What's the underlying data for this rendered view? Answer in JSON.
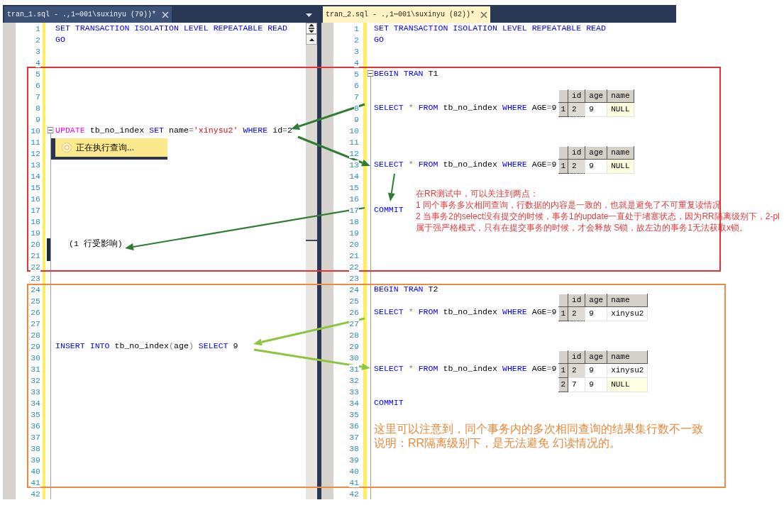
{
  "editor_left": {
    "tab": {
      "title": "tran_1.sql - .,1⋯001\\suxinyu (79))*",
      "selected": false
    },
    "lines": [
      {
        "number": "1",
        "tokens": [
          {
            "text": "SET TRANSACTION ISOLATION LEVEL REPEATABLE READ",
            "kind": "keyword"
          }
        ]
      },
      {
        "number": "2",
        "tokens": [
          {
            "text": "GO",
            "kind": "keyword"
          }
        ]
      },
      {
        "number": "3"
      },
      {
        "number": "4"
      },
      {
        "number": "5"
      },
      {
        "number": "6"
      },
      {
        "number": "7"
      },
      {
        "number": "8"
      },
      {
        "number": "9"
      },
      {
        "number": "10",
        "fold": true,
        "tokens": [
          {
            "text": "UPDATE",
            "kind": "special"
          },
          {
            "text": " tb_no_index ",
            "kind": "text"
          },
          {
            "text": "SET",
            "kind": "keyword"
          },
          {
            "text": " name",
            "kind": "text"
          },
          {
            "text": "=",
            "kind": "operator"
          },
          {
            "text": "'xinysu2'",
            "kind": "string"
          },
          {
            "text": " WHERE",
            "kind": "keyword"
          },
          {
            "text": " id",
            "kind": "text"
          },
          {
            "text": "=",
            "kind": "operator"
          },
          {
            "text": "2",
            "kind": "text"
          }
        ]
      },
      {
        "number": "11"
      },
      {
        "number": "12"
      },
      {
        "number": "13"
      },
      {
        "number": "14"
      },
      {
        "number": "15"
      },
      {
        "number": "16"
      },
      {
        "number": "17"
      },
      {
        "number": "18"
      },
      {
        "number": "19"
      },
      {
        "number": "20",
        "marker": true,
        "tokens": [
          {
            "text": "(1 行受影响)",
            "kind": "message"
          }
        ]
      },
      {
        "number": "21",
        "marker": true
      },
      {
        "number": "22"
      },
      {
        "number": "23"
      },
      {
        "number": "24"
      },
      {
        "number": "25"
      },
      {
        "number": "26"
      },
      {
        "number": "27"
      },
      {
        "number": "28"
      },
      {
        "number": "29",
        "tokens": [
          {
            "text": "INSERT INTO",
            "kind": "keyword"
          },
          {
            "text": " tb_no_index",
            "kind": "text"
          },
          {
            "text": "(",
            "kind": "operator"
          },
          {
            "text": "age",
            "kind": "text"
          },
          {
            "text": ")",
            "kind": "operator"
          },
          {
            "text": " SELECT",
            "kind": "keyword"
          },
          {
            "text": " 9",
            "kind": "text"
          }
        ]
      },
      {
        "number": "30"
      },
      {
        "number": "31"
      },
      {
        "number": "32"
      },
      {
        "number": "33"
      },
      {
        "number": "34"
      },
      {
        "number": "35"
      },
      {
        "number": "36"
      },
      {
        "number": "37"
      },
      {
        "number": "38"
      },
      {
        "number": "39"
      },
      {
        "number": "40"
      },
      {
        "number": "41"
      },
      {
        "number": "42"
      }
    ],
    "status_popup": {
      "text": "正在执行查询..."
    }
  },
  "editor_right": {
    "tab": {
      "title": "tran_2.sql - .,1⋯001\\suxinyu (82))*",
      "selected": true
    },
    "lines": [
      {
        "number": "1",
        "tokens": [
          {
            "text": "SET TRANSACTION ISOLATION LEVEL REPEATABLE READ",
            "kind": "keyword"
          }
        ]
      },
      {
        "number": "2",
        "tokens": [
          {
            "text": "GO",
            "kind": "keyword"
          }
        ]
      },
      {
        "number": "3"
      },
      {
        "number": "4"
      },
      {
        "number": "5",
        "fold": true,
        "tokens": [
          {
            "text": "BEGIN TRAN",
            "kind": "keyword"
          },
          {
            "text": " T1",
            "kind": "text"
          }
        ]
      },
      {
        "number": "6"
      },
      {
        "number": "7"
      },
      {
        "number": "8",
        "tokens": [
          {
            "text": "SELECT ",
            "kind": "keyword"
          },
          {
            "text": "*",
            "kind": "operator"
          },
          {
            "text": " FROM",
            "kind": "keyword"
          },
          {
            "text": " tb_no_index ",
            "kind": "text"
          },
          {
            "text": "WHERE",
            "kind": "keyword"
          },
          {
            "text": " AGE",
            "kind": "text"
          },
          {
            "text": "=",
            "kind": "operator"
          },
          {
            "text": "9",
            "kind": "text"
          }
        ],
        "result_grid": {
          "columns": [
            "id",
            "age",
            "name"
          ],
          "rows": [
            {
              "number": "1",
              "cells": [
                {
                  "text": "2",
                  "focused": true,
                  "null": false
                },
                {
                  "text": "9",
                  "focused": false,
                  "null": false
                },
                {
                  "text": "NULL",
                  "focused": false,
                  "null": true
                }
              ]
            }
          ]
        }
      },
      {
        "number": "9"
      },
      {
        "number": "10"
      },
      {
        "number": "11"
      },
      {
        "number": "12"
      },
      {
        "number": "13",
        "tokens": [
          {
            "text": "SELECT ",
            "kind": "keyword"
          },
          {
            "text": "*",
            "kind": "operator"
          },
          {
            "text": " FROM",
            "kind": "keyword"
          },
          {
            "text": " tb_no_index ",
            "kind": "text"
          },
          {
            "text": "WHERE",
            "kind": "keyword"
          },
          {
            "text": " AGE",
            "kind": "text"
          },
          {
            "text": "=",
            "kind": "operator"
          },
          {
            "text": "9",
            "kind": "text"
          }
        ],
        "result_grid": {
          "columns": [
            "id",
            "age",
            "name"
          ],
          "rows": [
            {
              "number": "1",
              "cells": [
                {
                  "text": "2",
                  "focused": true,
                  "null": false
                },
                {
                  "text": "9",
                  "focused": false,
                  "null": false
                },
                {
                  "text": "NULL",
                  "focused": false,
                  "null": true
                }
              ]
            }
          ]
        }
      },
      {
        "number": "14"
      },
      {
        "number": "15"
      },
      {
        "number": "16"
      },
      {
        "number": "17",
        "tokens": [
          {
            "text": "COMMIT",
            "kind": "keyword"
          }
        ]
      },
      {
        "number": "18"
      },
      {
        "number": "19"
      },
      {
        "number": "20"
      },
      {
        "number": "21"
      },
      {
        "number": "22"
      },
      {
        "number": "23"
      },
      {
        "number": "24",
        "tokens": [
          {
            "text": "BEGIN TRAN",
            "kind": "keyword"
          },
          {
            "text": " T2",
            "kind": "text"
          }
        ]
      },
      {
        "number": "25"
      },
      {
        "number": "26",
        "tokens": [
          {
            "text": "SELECT ",
            "kind": "keyword"
          },
          {
            "text": "*",
            "kind": "operator"
          },
          {
            "text": " FROM",
            "kind": "keyword"
          },
          {
            "text": " tb_no_index ",
            "kind": "text"
          },
          {
            "text": "WHERE",
            "kind": "keyword"
          },
          {
            "text": " AGE",
            "kind": "text"
          },
          {
            "text": "=",
            "kind": "operator"
          },
          {
            "text": "9",
            "kind": "text"
          }
        ],
        "result_grid": {
          "columns": [
            "id",
            "age",
            "name"
          ],
          "rows": [
            {
              "number": "1",
              "cells": [
                {
                  "text": "2",
                  "focused": true,
                  "null": false
                },
                {
                  "text": "9",
                  "focused": false,
                  "null": false
                },
                {
                  "text": "xinysu2",
                  "focused": false,
                  "null": false
                }
              ]
            }
          ]
        }
      },
      {
        "number": "27"
      },
      {
        "number": "28"
      },
      {
        "number": "29"
      },
      {
        "number": "30"
      },
      {
        "number": "31",
        "tokens": [
          {
            "text": "SELECT ",
            "kind": "keyword"
          },
          {
            "text": "*",
            "kind": "operator"
          },
          {
            "text": " FROM",
            "kind": "keyword"
          },
          {
            "text": " tb_no_index ",
            "kind": "text"
          },
          {
            "text": "WHERE",
            "kind": "keyword"
          },
          {
            "text": " AGE",
            "kind": "text"
          },
          {
            "text": "=",
            "kind": "operator"
          },
          {
            "text": "9",
            "kind": "text"
          }
        ],
        "result_grid": {
          "columns": [
            "id",
            "age",
            "name"
          ],
          "rows": [
            {
              "number": "1",
              "cells": [
                {
                  "text": "2",
                  "focused": true,
                  "null": false
                },
                {
                  "text": "9",
                  "focused": false,
                  "null": false
                },
                {
                  "text": "xinysu2",
                  "focused": false,
                  "null": false
                }
              ]
            },
            {
              "number": "2",
              "cells": [
                {
                  "text": "7",
                  "focused": false,
                  "null": false
                },
                {
                  "text": "9",
                  "focused": false,
                  "null": false
                },
                {
                  "text": "NULL",
                  "focused": false,
                  "null": true
                }
              ]
            }
          ]
        }
      },
      {
        "number": "32"
      },
      {
        "number": "33"
      },
      {
        "number": "34",
        "tokens": [
          {
            "text": "COMMIT",
            "kind": "keyword"
          }
        ]
      },
      {
        "number": "35"
      },
      {
        "number": "36"
      },
      {
        "number": "37"
      },
      {
        "number": "38"
      },
      {
        "number": "39"
      },
      {
        "number": "40"
      },
      {
        "number": "41"
      },
      {
        "number": "42"
      }
    ]
  },
  "annotations": {
    "t1_note": [
      "在RR测试中，可以关注到两点：",
      "1 同个事务多次相同查询，行数据的内容是一致的，也就是避免了不可重复读情况",
      "2 当事务2的select没有提交的时候，事务1的update一直处于堵塞状态，因为RR隔离级别下，2-pl属于强严格模式，只有在提交事务的时候，才会释放 S锁，故左边的事务1无法获取x锁。"
    ],
    "t2_note": [
      "这里可以注意到，同个事务内的多次相同查询的结果集行数不一致",
      "说明：RR隔离级别下，是无法避免 幻读情况的。"
    ]
  }
}
